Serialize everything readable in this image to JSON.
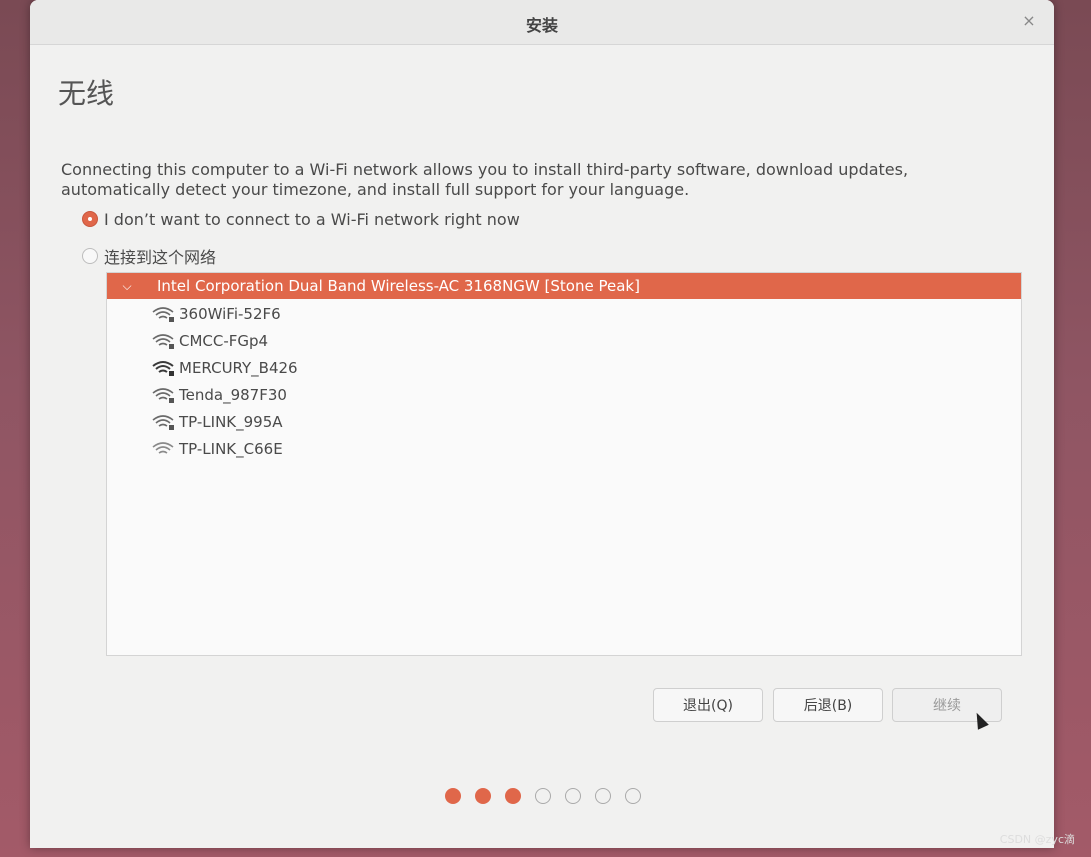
{
  "window": {
    "title": "安装",
    "close_glyph": "×"
  },
  "page": {
    "heading": "无线",
    "description": "Connecting this computer to a Wi-Fi network allows you to install third-party software, download updates, automatically detect your timezone, and install full support for your language."
  },
  "options": [
    {
      "label": "I don’t want to connect to a Wi-Fi network right now",
      "selected": true
    },
    {
      "label": "连接到这个网络",
      "selected": false
    }
  ],
  "device": {
    "label": "Intel Corporation Dual Band Wireless-AC 3168NGW [Stone Peak]",
    "expanded_glyph": "⌵"
  },
  "networks": [
    {
      "ssid": "360WiFi-52F6",
      "icon": "wifi-locked-icon"
    },
    {
      "ssid": "CMCC-FGp4",
      "icon": "wifi-locked-icon"
    },
    {
      "ssid": "MERCURY_B426",
      "icon": "wifi-locked-icon"
    },
    {
      "ssid": "Tenda_987F30",
      "icon": "wifi-locked-icon"
    },
    {
      "ssid": "TP-LINK_995A",
      "icon": "wifi-locked-icon"
    },
    {
      "ssid": "TP-LINK_C66E",
      "icon": "wifi-icon"
    }
  ],
  "buttons": {
    "quit": "退出(Q)",
    "back": "后退(B)",
    "continue": "继续"
  },
  "progress": {
    "total_steps": 7,
    "completed_steps": 3
  },
  "colors": {
    "accent": "#e0674a",
    "window_bg": "#f1f1f0"
  },
  "watermark": "CSDN @zyc滴"
}
